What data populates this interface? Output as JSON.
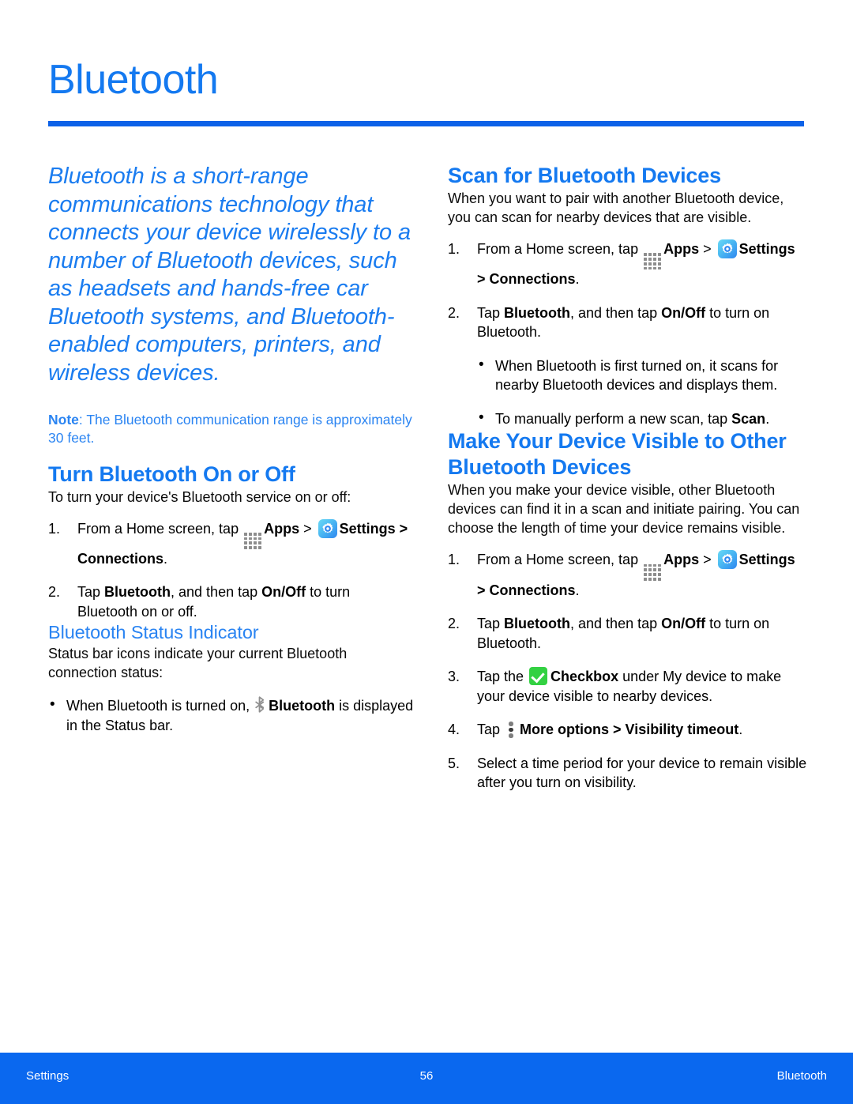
{
  "document": {
    "title": "Bluetooth",
    "accent_color": "#1479f0",
    "rule_color": "#0d62e8",
    "footer_color": "#0a68ef"
  },
  "left_column": {
    "intro": "Bluetooth is a short-range communications technology that connects your device wirelessly to a number of Bluetooth devices, such as headsets and hands-free car Bluetooth systems, and Bluetooth-enabled computers, printers, and wireless devices.",
    "note": {
      "label": "Note",
      "separator": ": ",
      "text": "The Bluetooth communication range is approximately 30 feet."
    },
    "turn_on_off": {
      "heading": "Turn Bluetooth On or Off",
      "intro": "To turn your device's Bluetooth service on or off:",
      "step1": {
        "num": "1.",
        "t1": "From a Home screen, tap ",
        "apps": "Apps",
        "t2": " > ",
        "settings": "Settings",
        "t3": " > ",
        "connections": "Connections",
        "t4": "."
      },
      "step2": {
        "num": "2.",
        "t1": "Tap ",
        "bluetooth": "Bluetooth",
        "t2": ", and then tap ",
        "onoff": "On/Off",
        "t3": " to turn Bluetooth on or off."
      }
    },
    "status_indicator": {
      "heading": "Bluetooth Status Indicator",
      "intro": "Status bar icons indicate your current Bluetooth connection status:",
      "bullet": {
        "t1": "When Bluetooth is turned on, ",
        "bold": "Bluetooth",
        "t2": " is displayed in the Status bar."
      }
    }
  },
  "right_column": {
    "scan": {
      "heading": "Scan for Bluetooth Devices",
      "intro": "When you want to pair with another Bluetooth device, you can scan for nearby devices that are visible.",
      "step1": {
        "num": "1.",
        "t1": "From a Home screen, tap ",
        "apps": "Apps",
        "t2": " > ",
        "settings": "Settings",
        "t3": " > ",
        "connections": "Connections",
        "t4": "."
      },
      "step2": {
        "num": "2.",
        "t1": "Tap ",
        "bluetooth": "Bluetooth",
        "t2": ", and then tap ",
        "onoff": "On/Off",
        "t3": " to turn on Bluetooth."
      },
      "bullet1": "When Bluetooth is first turned on, it scans for nearby Bluetooth devices and displays them.",
      "bullet2": {
        "t1": "To manually perform a new scan, tap ",
        "bold": "Scan",
        "t2": "."
      }
    },
    "visible": {
      "heading": "Make Your Device Visible to Other Bluetooth Devices",
      "intro": "When you make your device visible, other Bluetooth devices can find it in a scan and initiate pairing. You can choose the length of time your device remains visible.",
      "step1": {
        "num": "1.",
        "t1": "From a Home screen, tap ",
        "apps": "Apps",
        "t2": " > ",
        "settings": "Settings",
        "t3": " > ",
        "connections": "Connections",
        "t4": "."
      },
      "step2": {
        "num": "2.",
        "t1": "Tap ",
        "bluetooth": "Bluetooth",
        "t2": ", and then tap ",
        "onoff": "On/Off",
        "t3": " to turn on Bluetooth."
      },
      "step3": {
        "num": "3.",
        "t1": "Tap the ",
        "checkbox": "Checkbox",
        "t2": " under My device to make your device visible to nearby devices."
      },
      "step4": {
        "num": "4.",
        "t1": "Tap ",
        "more_options": "More options",
        "t2": " > ",
        "visibility_timeout": "Visibility timeout",
        "t3": "."
      },
      "step5": {
        "num": "5.",
        "t1": "Select a time period for your device to remain visible after you turn on visibility."
      }
    }
  },
  "footer": {
    "left": "Settings",
    "page_number": "56",
    "right": "Bluetooth"
  }
}
